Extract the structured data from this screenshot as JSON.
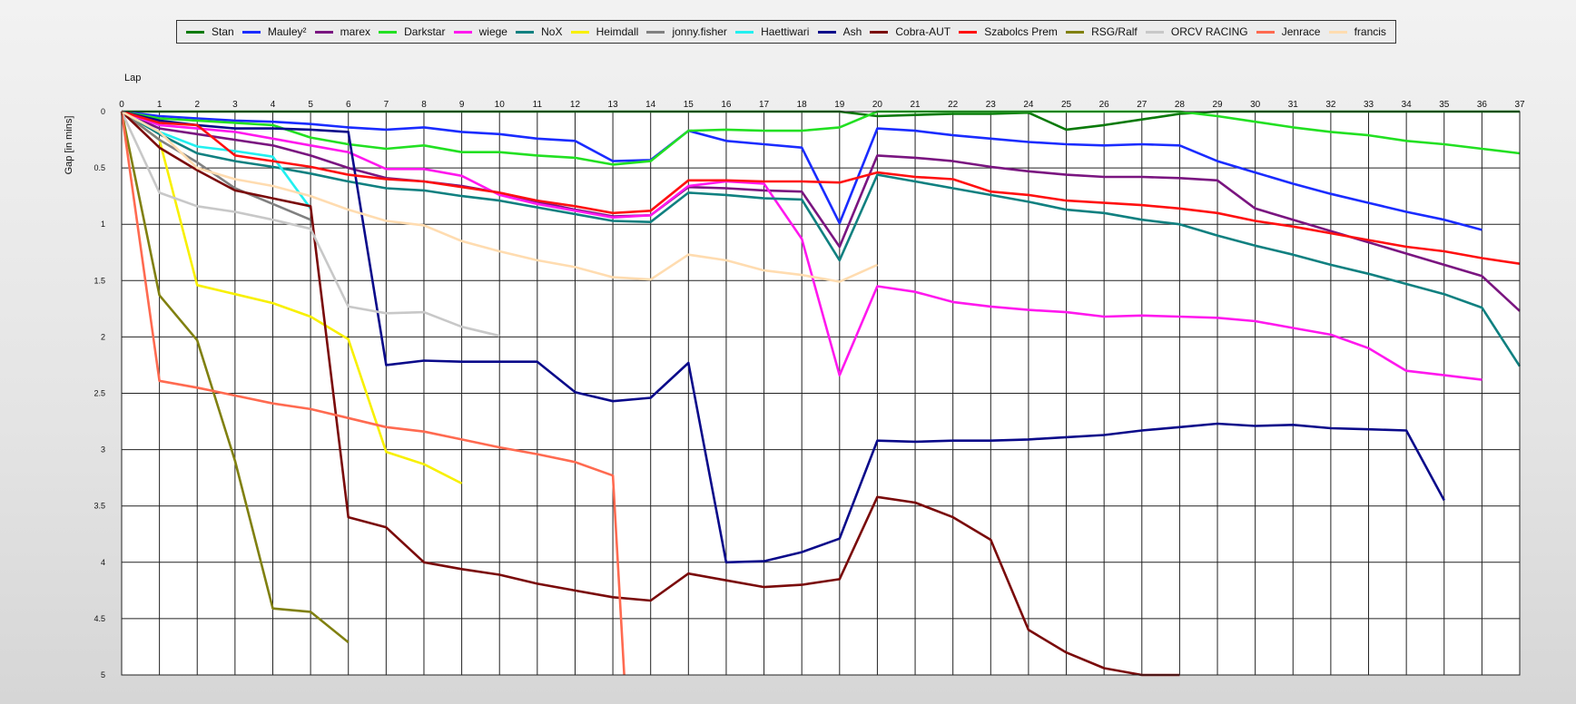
{
  "chart_data": {
    "type": "line",
    "xlabel": "Lap",
    "ylabel": "Gap [in mins]",
    "xlim": [
      0,
      37
    ],
    "ylim": [
      0,
      5
    ],
    "y_inverted": true,
    "x_ticks": [
      0,
      1,
      2,
      3,
      4,
      5,
      6,
      7,
      8,
      9,
      10,
      11,
      12,
      13,
      14,
      15,
      16,
      17,
      18,
      19,
      20,
      21,
      22,
      23,
      24,
      25,
      26,
      27,
      28,
      29,
      30,
      31,
      32,
      33,
      34,
      35,
      36,
      37
    ],
    "y_ticks": [
      "0",
      "0.5",
      "1",
      "1.5",
      "2",
      "2.5",
      "3",
      "3.5",
      "4",
      "4.5",
      "5"
    ],
    "grid": true,
    "legend": "top",
    "series": [
      {
        "name": "Stan",
        "color": "#0a7a0a",
        "x": [
          0,
          1,
          2,
          3,
          4,
          5,
          6,
          7,
          8,
          9,
          10,
          11,
          12,
          13,
          14,
          15,
          16,
          17,
          18,
          19,
          20,
          21,
          22,
          23,
          24,
          25,
          26,
          27,
          28,
          29,
          30,
          31,
          32,
          33,
          34,
          35,
          36,
          37
        ],
        "values": [
          0,
          0,
          0,
          0,
          0,
          0,
          0,
          0,
          0,
          0,
          0,
          0,
          0,
          0,
          0,
          0,
          0,
          0,
          0,
          0,
          0.04,
          0.03,
          0.02,
          0.02,
          0.01,
          0.16,
          0.12,
          0.07,
          0.02,
          0,
          0,
          0,
          0,
          0,
          0,
          0,
          0,
          0
        ]
      },
      {
        "name": "Mauley²",
        "color": "#1a2cff",
        "x": [
          0,
          1,
          2,
          3,
          4,
          5,
          6,
          7,
          8,
          9,
          10,
          11,
          12,
          13,
          14,
          15,
          16,
          17,
          18,
          19,
          20,
          21,
          22,
          23,
          24,
          25,
          26,
          27,
          28,
          29,
          30,
          31,
          32,
          33,
          34,
          35,
          36
        ],
        "values": [
          0,
          0.04,
          0.06,
          0.08,
          0.09,
          0.11,
          0.14,
          0.16,
          0.14,
          0.18,
          0.2,
          0.24,
          0.26,
          0.44,
          0.43,
          0.17,
          0.26,
          0.29,
          0.32,
          0.99,
          0.15,
          0.17,
          0.21,
          0.24,
          0.27,
          0.29,
          0.3,
          0.29,
          0.3,
          0.44,
          0.54,
          0.64,
          0.73,
          0.81,
          0.89,
          0.96,
          1.05
        ]
      },
      {
        "name": "marex",
        "color": "#7a1580",
        "x": [
          0,
          1,
          2,
          3,
          4,
          5,
          6,
          7,
          8,
          9,
          10,
          11,
          12,
          13,
          14,
          15,
          16,
          17,
          18,
          19,
          20,
          21,
          22,
          23,
          24,
          25,
          26,
          27,
          28,
          29,
          30,
          31,
          32,
          33,
          34,
          35,
          36,
          37
        ],
        "values": [
          0,
          0.15,
          0.2,
          0.25,
          0.3,
          0.39,
          0.5,
          0.59,
          0.62,
          0.66,
          0.72,
          0.8,
          0.87,
          0.93,
          0.92,
          0.67,
          0.68,
          0.7,
          0.71,
          1.2,
          0.39,
          0.41,
          0.44,
          0.49,
          0.53,
          0.56,
          0.58,
          0.58,
          0.59,
          0.61,
          0.86,
          0.96,
          1.06,
          1.16,
          1.26,
          1.36,
          1.46,
          1.77
        ]
      },
      {
        "name": "Darkstar",
        "color": "#22e022",
        "x": [
          0,
          1,
          2,
          3,
          4,
          5,
          6,
          7,
          8,
          9,
          10,
          11,
          12,
          13,
          14,
          15,
          16,
          17,
          18,
          19,
          20,
          21,
          22,
          23,
          24,
          25,
          26,
          27,
          28,
          29,
          30,
          31,
          32,
          33,
          34,
          35,
          36,
          37
        ],
        "values": [
          0,
          0.06,
          0.08,
          0.1,
          0.12,
          0.23,
          0.29,
          0.33,
          0.3,
          0.36,
          0.36,
          0.39,
          0.41,
          0.47,
          0.44,
          0.17,
          0.16,
          0.17,
          0.17,
          0.14,
          0,
          0,
          0,
          0,
          0,
          0,
          0,
          0,
          0,
          0.04,
          0.09,
          0.14,
          0.18,
          0.21,
          0.26,
          0.29,
          0.33,
          0.37
        ]
      },
      {
        "name": "wiege",
        "color": "#ff18ee",
        "x": [
          0,
          1,
          2,
          3,
          4,
          5,
          6,
          7,
          8,
          9,
          10,
          11,
          12,
          13,
          14,
          15,
          16,
          17,
          18,
          19,
          20,
          21,
          22,
          23,
          24,
          25,
          26,
          27,
          28,
          29,
          30,
          31,
          32,
          33,
          34,
          35,
          36
        ],
        "values": [
          0,
          0.12,
          0.15,
          0.18,
          0.24,
          0.3,
          0.36,
          0.51,
          0.51,
          0.57,
          0.74,
          0.82,
          0.88,
          0.94,
          0.92,
          0.66,
          0.62,
          0.64,
          1.13,
          2.34,
          1.55,
          1.6,
          1.69,
          1.73,
          1.76,
          1.78,
          1.82,
          1.81,
          1.82,
          1.83,
          1.86,
          1.92,
          1.98,
          2.1,
          2.3,
          2.34,
          2.38
        ]
      },
      {
        "name": "NoX",
        "color": "#108080",
        "x": [
          0,
          1,
          2,
          3,
          4,
          5,
          6,
          7,
          8,
          9,
          10,
          11,
          12,
          13,
          14,
          15,
          16,
          17,
          18,
          19,
          20,
          21,
          22,
          23,
          24,
          25,
          26,
          27,
          28,
          29,
          30,
          31,
          32,
          33,
          34,
          35,
          36,
          37
        ],
        "values": [
          0,
          0.2,
          0.37,
          0.44,
          0.49,
          0.55,
          0.62,
          0.68,
          0.7,
          0.75,
          0.79,
          0.85,
          0.91,
          0.97,
          0.98,
          0.72,
          0.74,
          0.77,
          0.78,
          1.32,
          0.56,
          0.62,
          0.68,
          0.74,
          0.8,
          0.87,
          0.9,
          0.96,
          1.0,
          1.1,
          1.19,
          1.27,
          1.36,
          1.44,
          1.53,
          1.62,
          1.74,
          2.26
        ]
      },
      {
        "name": "Heimdall",
        "color": "#f8f000",
        "x": [
          0,
          1,
          2,
          3,
          4,
          5,
          6,
          7,
          8,
          9
        ],
        "values": [
          0,
          0.25,
          1.54,
          1.62,
          1.7,
          1.82,
          2.02,
          3.02,
          3.13,
          3.3
        ]
      },
      {
        "name": "jonny.fisher",
        "color": "#808080",
        "x": [
          0,
          1,
          2,
          3,
          4,
          5
        ],
        "values": [
          0,
          0.25,
          0.45,
          0.68,
          0.82,
          0.96
        ]
      },
      {
        "name": "Haettiwari",
        "color": "#22f0f0",
        "x": [
          0,
          1,
          2,
          3,
          4,
          5
        ],
        "values": [
          0,
          0.18,
          0.31,
          0.35,
          0.4,
          0.86
        ]
      },
      {
        "name": "Ash",
        "color": "#0a0a8a",
        "x": [
          0,
          1,
          2,
          3,
          4,
          5,
          6,
          7,
          8,
          9,
          10,
          11,
          12,
          13,
          14,
          15,
          16,
          17,
          18,
          19,
          20,
          21,
          22,
          23,
          24,
          25,
          26,
          27,
          28,
          29,
          30,
          31,
          32,
          33,
          34,
          35
        ],
        "values": [
          0,
          0.08,
          0.12,
          0.15,
          0.15,
          0.16,
          0.18,
          2.25,
          2.21,
          2.22,
          2.22,
          2.22,
          2.49,
          2.57,
          2.54,
          2.23,
          4.0,
          3.99,
          3.91,
          3.79,
          2.92,
          2.93,
          2.92,
          2.92,
          2.91,
          2.89,
          2.87,
          2.83,
          2.8,
          2.77,
          2.79,
          2.78,
          2.81,
          2.82,
          2.83,
          3.45
        ]
      },
      {
        "name": "Cobra-AUT",
        "color": "#7a0a0a",
        "x": [
          0,
          1,
          2,
          3,
          4,
          5,
          6,
          7,
          8,
          9,
          10,
          11,
          12,
          13,
          14,
          15,
          16,
          17,
          18,
          19,
          20,
          21,
          22,
          23,
          24,
          25,
          26,
          27,
          28
        ],
        "values": [
          0,
          0.32,
          0.52,
          0.7,
          0.77,
          0.84,
          3.6,
          3.69,
          4.0,
          4.06,
          4.11,
          4.19,
          4.25,
          4.31,
          4.34,
          4.1,
          4.16,
          4.22,
          4.2,
          4.15,
          3.42,
          3.47,
          3.6,
          3.8,
          4.6,
          4.8,
          4.94,
          5.0,
          5.04
        ]
      },
      {
        "name": "Szabolcs Prem",
        "color": "#ff1010",
        "x": [
          0,
          1,
          2,
          3,
          4,
          5,
          6,
          7,
          8,
          9,
          10,
          11,
          12,
          13,
          14,
          15,
          16,
          17,
          18,
          19,
          20,
          21,
          22,
          23,
          24,
          25,
          26,
          27,
          28,
          29,
          30,
          31,
          32,
          33,
          34,
          35,
          36,
          37
        ],
        "values": [
          0,
          0.1,
          0.12,
          0.39,
          0.44,
          0.49,
          0.56,
          0.6,
          0.62,
          0.67,
          0.72,
          0.79,
          0.84,
          0.9,
          0.88,
          0.61,
          0.61,
          0.62,
          0.62,
          0.63,
          0.54,
          0.58,
          0.6,
          0.71,
          0.74,
          0.79,
          0.81,
          0.83,
          0.86,
          0.9,
          0.97,
          1.02,
          1.08,
          1.14,
          1.2,
          1.24,
          1.3,
          1.35
        ]
      },
      {
        "name": "RSG/Ralf",
        "color": "#808010",
        "x": [
          0,
          1,
          2,
          3,
          4,
          5,
          6
        ],
        "values": [
          0,
          1.63,
          2.03,
          3.1,
          4.41,
          4.44,
          4.71
        ]
      },
      {
        "name": "ORCV RACING",
        "color": "#c8c8c8",
        "x": [
          0,
          1,
          2,
          3,
          4,
          5,
          6,
          7,
          8,
          9,
          10
        ],
        "values": [
          0,
          0.72,
          0.84,
          0.89,
          0.96,
          1.04,
          1.73,
          1.79,
          1.78,
          1.91,
          1.99
        ]
      },
      {
        "name": "Jenrace",
        "color": "#ff6a50",
        "x": [
          0,
          1,
          2,
          3,
          4,
          5,
          6,
          7,
          8,
          9,
          10,
          11,
          12,
          13,
          13.3
        ],
        "values": [
          0,
          2.39,
          2.45,
          2.52,
          2.59,
          2.64,
          2.72,
          2.8,
          2.84,
          2.91,
          2.98,
          3.04,
          3.11,
          3.23,
          5.05
        ]
      },
      {
        "name": "francis",
        "color": "#ffdcb0",
        "x": [
          0,
          1,
          2,
          3,
          4,
          5,
          6,
          7,
          8,
          9,
          10,
          11,
          12,
          13,
          14,
          15,
          16,
          17,
          18,
          19,
          20
        ],
        "values": [
          0,
          0.18,
          0.5,
          0.6,
          0.66,
          0.75,
          0.87,
          0.97,
          1.01,
          1.15,
          1.24,
          1.32,
          1.38,
          1.47,
          1.49,
          1.27,
          1.32,
          1.41,
          1.45,
          1.51,
          1.36
        ]
      }
    ]
  }
}
